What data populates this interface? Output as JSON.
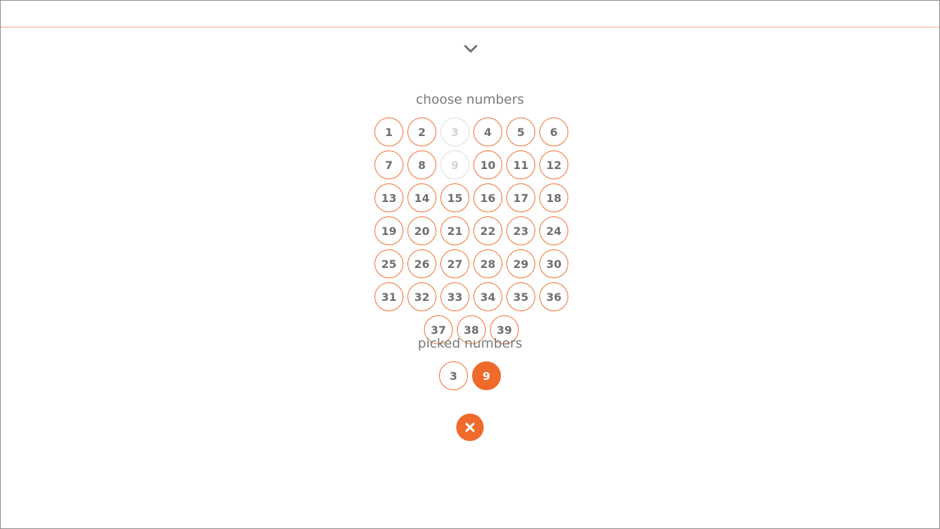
{
  "header": {
    "collapse_icon": "chevron-down-icon"
  },
  "choose": {
    "title": "choose numbers",
    "numbers": [
      {
        "label": "1",
        "disabled": false
      },
      {
        "label": "2",
        "disabled": false
      },
      {
        "label": "3",
        "disabled": true
      },
      {
        "label": "4",
        "disabled": false
      },
      {
        "label": "5",
        "disabled": false
      },
      {
        "label": "6",
        "disabled": false
      },
      {
        "label": "7",
        "disabled": false
      },
      {
        "label": "8",
        "disabled": false
      },
      {
        "label": "9",
        "disabled": true
      },
      {
        "label": "10",
        "disabled": false
      },
      {
        "label": "11",
        "disabled": false
      },
      {
        "label": "12",
        "disabled": false
      },
      {
        "label": "13",
        "disabled": false
      },
      {
        "label": "14",
        "disabled": false
      },
      {
        "label": "15",
        "disabled": false
      },
      {
        "label": "16",
        "disabled": false
      },
      {
        "label": "17",
        "disabled": false
      },
      {
        "label": "18",
        "disabled": false
      },
      {
        "label": "19",
        "disabled": false
      },
      {
        "label": "20",
        "disabled": false
      },
      {
        "label": "21",
        "disabled": false
      },
      {
        "label": "22",
        "disabled": false
      },
      {
        "label": "23",
        "disabled": false
      },
      {
        "label": "24",
        "disabled": false
      },
      {
        "label": "25",
        "disabled": false
      },
      {
        "label": "26",
        "disabled": false
      },
      {
        "label": "27",
        "disabled": false
      },
      {
        "label": "28",
        "disabled": false
      },
      {
        "label": "29",
        "disabled": false
      },
      {
        "label": "30",
        "disabled": false
      },
      {
        "label": "31",
        "disabled": false
      },
      {
        "label": "32",
        "disabled": false
      },
      {
        "label": "33",
        "disabled": false
      },
      {
        "label": "34",
        "disabled": false
      },
      {
        "label": "35",
        "disabled": false
      },
      {
        "label": "36",
        "disabled": false
      },
      {
        "label": "37",
        "disabled": false
      },
      {
        "label": "38",
        "disabled": false
      },
      {
        "label": "39",
        "disabled": false
      }
    ]
  },
  "picked": {
    "title": "picked numbers",
    "numbers": [
      {
        "label": "3",
        "filled": false
      },
      {
        "label": "9",
        "filled": true
      }
    ]
  },
  "clear_button": {
    "icon": "close-icon"
  },
  "colors": {
    "accent": "#f06a2b",
    "text": "#6f6f6f",
    "disabled": "#d4d4d4"
  }
}
